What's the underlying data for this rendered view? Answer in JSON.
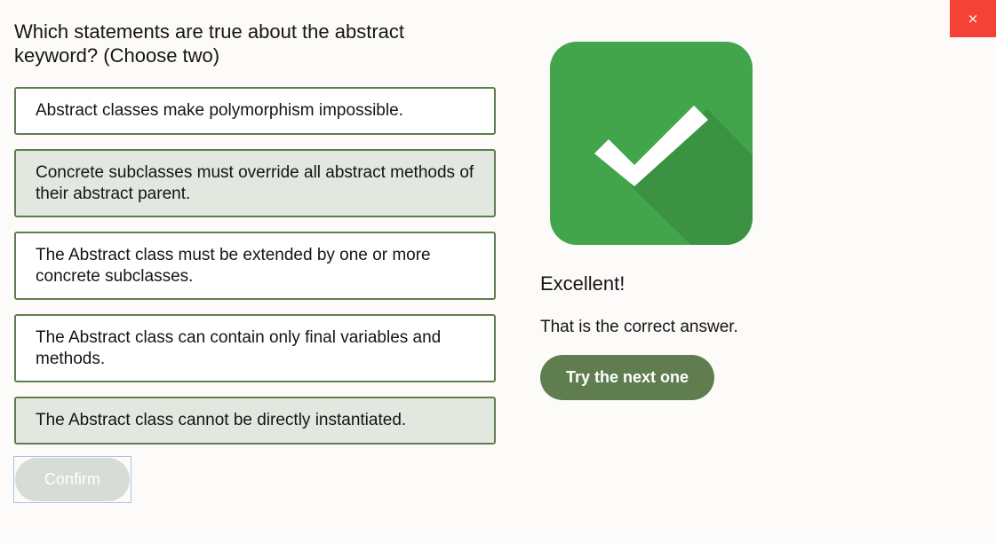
{
  "close_button": {
    "label": "×"
  },
  "question": {
    "text": "Which statements are true about the abstract keyword? (Choose two)"
  },
  "options": [
    {
      "text": "Abstract classes make polymorphism impossible.",
      "selected": false
    },
    {
      "text": "Concrete subclasses must override all abstract methods of their abstract parent.",
      "selected": true
    },
    {
      "text": "The Abstract class must be extended by one or more concrete subclasses.",
      "selected": false
    },
    {
      "text": "The Abstract class can contain only final variables and methods.",
      "selected": false
    },
    {
      "text": "The Abstract class cannot be directly instantiated.",
      "selected": true
    }
  ],
  "confirm_button": {
    "label": "Confirm",
    "enabled": false
  },
  "feedback": {
    "icon": "checkmark-icon",
    "title": "Excellent!",
    "message": "That is the correct answer.",
    "next_label": "Try the next one"
  },
  "colors": {
    "accent_green": "#5f7d4f",
    "success_green": "#43a54b",
    "close_red": "#f44336",
    "selected_bg": "#e2e7df"
  }
}
